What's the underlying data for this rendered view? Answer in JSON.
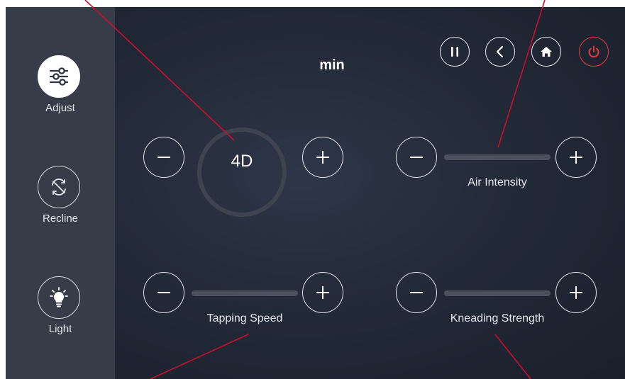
{
  "header": {
    "title": "min"
  },
  "sidebar": {
    "items": [
      {
        "label": "Adjust",
        "icon": "sliders-icon",
        "active": true
      },
      {
        "label": "Recline",
        "icon": "rotate-icon",
        "active": false
      },
      {
        "label": "Light",
        "icon": "lightbulb-icon",
        "active": false
      }
    ]
  },
  "toolbar": {
    "buttons": [
      "pause-icon",
      "back-chevron-icon",
      "home-icon",
      "power-icon"
    ]
  },
  "controls": {
    "mode": {
      "value": "4D"
    },
    "air": {
      "label": "Air Intensity"
    },
    "tapping": {
      "label": "Tapping Speed"
    },
    "kneading": {
      "label": "Kneading Strength"
    }
  },
  "colors": {
    "background": "#232a38",
    "sidebar": "#363d48",
    "accent_power": "#e53a3a",
    "annotation_line": "#c8102e",
    "track": "#4a515d"
  }
}
